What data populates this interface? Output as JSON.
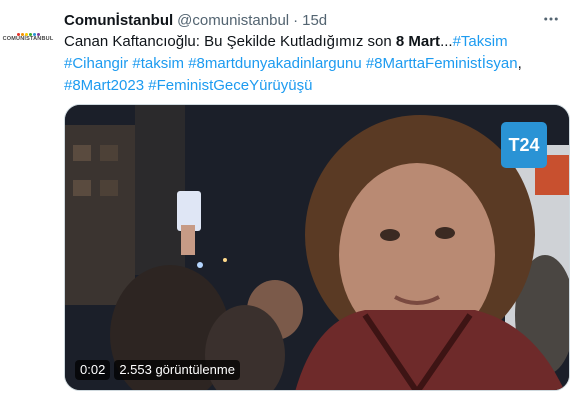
{
  "account": {
    "name": "Comunİstanbul",
    "handle": "@comunistanbul",
    "separator": "·",
    "time": "15d",
    "avatar_text": "COMUNİSTANBUL",
    "avatar_dot_colors": [
      "#e6332a",
      "#f39200",
      "#ffcc00",
      "#3aaa35",
      "#2a93d5",
      "#7b3f98"
    ]
  },
  "more_icon": "more-horizontal-icon",
  "tweet": {
    "text_lead": "Canan Kaftancıoğlu: Bu Şekilde Kutladığımız son ",
    "text_bold": "8 Mart",
    "text_ellipsis": "...",
    "hashtags_line1": "#Taksim",
    "hashtags_line2": "#Cihangir #taksim #8martdunyakadinlargunu #8MarttaFeministİsyan",
    "line2_trailing": ",",
    "hashtags_line3": "#8Mart2023 #FeministGeceYürüyüşü"
  },
  "video": {
    "logo": "T24",
    "duration": "0:02",
    "views": "2.553 görüntülenme"
  },
  "colors": {
    "link": "#1d9bf0",
    "secondary": "#536471",
    "logo_bg": "#2a93d5"
  }
}
